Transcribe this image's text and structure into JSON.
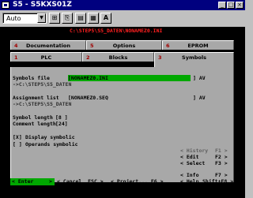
{
  "window": {
    "title": "S5 - S5KXS01Z",
    "controls": [
      "_",
      "□",
      "×"
    ]
  },
  "toolbar": {
    "font_select": "Auto",
    "font_select_arrow": "▼",
    "buttons": [
      "⊞",
      "⎘",
      "▤",
      "▦",
      "A"
    ]
  },
  "header": {
    "path": "C:\\STEP5\\S5_DATEN\\NONAMEZ0.INI"
  },
  "tabs_back": [
    {
      "num": "4",
      "label": "Documentation"
    },
    {
      "num": "5",
      "label": "Options"
    },
    {
      "num": "6",
      "label": "EPROM"
    }
  ],
  "tabs_front": [
    {
      "num": "1",
      "label": "PLC"
    },
    {
      "num": "2",
      "label": "Blocks"
    },
    {
      "num": "3",
      "label": "Symbols"
    }
  ],
  "form": {
    "symbols_file_label": "Symbols file",
    "symbols_file_value": "[NONAMEZ0.INI",
    "symbols_file_suffix": "] AV",
    "symbols_file_path": "->C:\\STEP5\\S5_DATEN",
    "assignment_list_label": "Assignment list",
    "assignment_list_value": "[NONAMEZ0.SEQ",
    "assignment_list_suffix": "] AV",
    "assignment_list_path": "->C:\\STEP5\\S5_DATEN",
    "symbol_length_label": "Symbol length",
    "symbol_length_value": "[8 ]",
    "comment_length_label": "Comment length",
    "comment_length_value": "[24]",
    "display_symbolic_check": "[X]",
    "display_symbolic_label": "Display symbolic",
    "operands_symbolic_check": "[ ]",
    "operands_symbolic_label": "Operands symbolic"
  },
  "fn_keys": [
    {
      "label": "< History",
      "key": "F1 >"
    },
    {
      "label": "< Edit",
      "key": "F2 >"
    },
    {
      "label": "< Select",
      "key": "F3 >"
    },
    {
      "label": "< Info",
      "key": "F7 >"
    },
    {
      "label": "< Help",
      "key": "Shift+F8 >"
    }
  ],
  "bottom_bar": {
    "enter": "< Enter",
    "enter_end": ">",
    "cancel": "< Cancel  ESC >",
    "project": "< Project... F6 >"
  }
}
